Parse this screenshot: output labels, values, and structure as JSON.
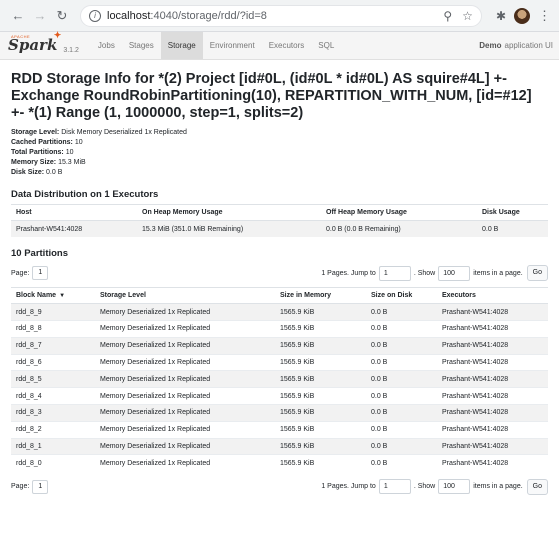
{
  "browser": {
    "url_host": "localhost",
    "url_path": ":4040/storage/rdd/?id=8"
  },
  "spark_nav": {
    "brand_top": "APACHE",
    "brand": "Spark",
    "version": "3.1.2",
    "tabs": [
      {
        "label": "Jobs"
      },
      {
        "label": "Stages"
      },
      {
        "label": "Storage"
      },
      {
        "label": "Environment"
      },
      {
        "label": "Executors"
      },
      {
        "label": "SQL"
      }
    ],
    "app_name_bold": "Demo",
    "app_name_rest": "application UI"
  },
  "page": {
    "title": "RDD Storage Info for *(2) Project [id#0L, (id#0L * id#0L) AS squire#4L] +- Exchange RoundRobinPartitioning(10), REPARTITION_WITH_NUM, [id=#12] +- *(1) Range (1, 1000000, step=1, splits=2)",
    "summary": [
      {
        "label": "Storage Level:",
        "value": "Disk Memory Deserialized 1x Replicated"
      },
      {
        "label": "Cached Partitions:",
        "value": "10"
      },
      {
        "label": "Total Partitions:",
        "value": "10"
      },
      {
        "label": "Memory Size:",
        "value": "15.3 MiB"
      },
      {
        "label": "Disk Size:",
        "value": "0.0 B"
      }
    ]
  },
  "distribution": {
    "heading": "Data Distribution on 1 Executors",
    "columns": [
      "Host",
      "On Heap Memory Usage",
      "Off Heap Memory Usage",
      "Disk Usage"
    ],
    "rows": [
      [
        "Prashant-W541:4028",
        "15.3 MiB (351.0 MiB Remaining)",
        "0.0 B (0.0 B Remaining)",
        "0.0 B"
      ]
    ]
  },
  "partitions": {
    "heading": "10 Partitions",
    "pager": {
      "page_label": "Page:",
      "page_value": "1",
      "pages_text": "1 Pages. Jump to",
      "jump_value": "1",
      "show_text": ". Show",
      "show_value": "100",
      "items_text": "items in a page.",
      "go_label": "Go"
    },
    "columns": [
      "Block Name",
      "Storage Level",
      "Size in Memory",
      "Size on Disk",
      "Executors"
    ],
    "sort_caret": "▼",
    "rows": [
      [
        "rdd_8_9",
        "Memory Deserialized 1x Replicated",
        "1565.9 KiB",
        "0.0 B",
        "Prashant-W541:4028"
      ],
      [
        "rdd_8_8",
        "Memory Deserialized 1x Replicated",
        "1565.9 KiB",
        "0.0 B",
        "Prashant-W541:4028"
      ],
      [
        "rdd_8_7",
        "Memory Deserialized 1x Replicated",
        "1565.9 KiB",
        "0.0 B",
        "Prashant-W541:4028"
      ],
      [
        "rdd_8_6",
        "Memory Deserialized 1x Replicated",
        "1565.9 KiB",
        "0.0 B",
        "Prashant-W541:4028"
      ],
      [
        "rdd_8_5",
        "Memory Deserialized 1x Replicated",
        "1565.9 KiB",
        "0.0 B",
        "Prashant-W541:4028"
      ],
      [
        "rdd_8_4",
        "Memory Deserialized 1x Replicated",
        "1565.9 KiB",
        "0.0 B",
        "Prashant-W541:4028"
      ],
      [
        "rdd_8_3",
        "Memory Deserialized 1x Replicated",
        "1565.9 KiB",
        "0.0 B",
        "Prashant-W541:4028"
      ],
      [
        "rdd_8_2",
        "Memory Deserialized 1x Replicated",
        "1565.9 KiB",
        "0.0 B",
        "Prashant-W541:4028"
      ],
      [
        "rdd_8_1",
        "Memory Deserialized 1x Replicated",
        "1565.9 KiB",
        "0.0 B",
        "Prashant-W541:4028"
      ],
      [
        "rdd_8_0",
        "Memory Deserialized 1x Replicated",
        "1565.9 KiB",
        "0.0 B",
        "Prashant-W541:4028"
      ]
    ]
  }
}
